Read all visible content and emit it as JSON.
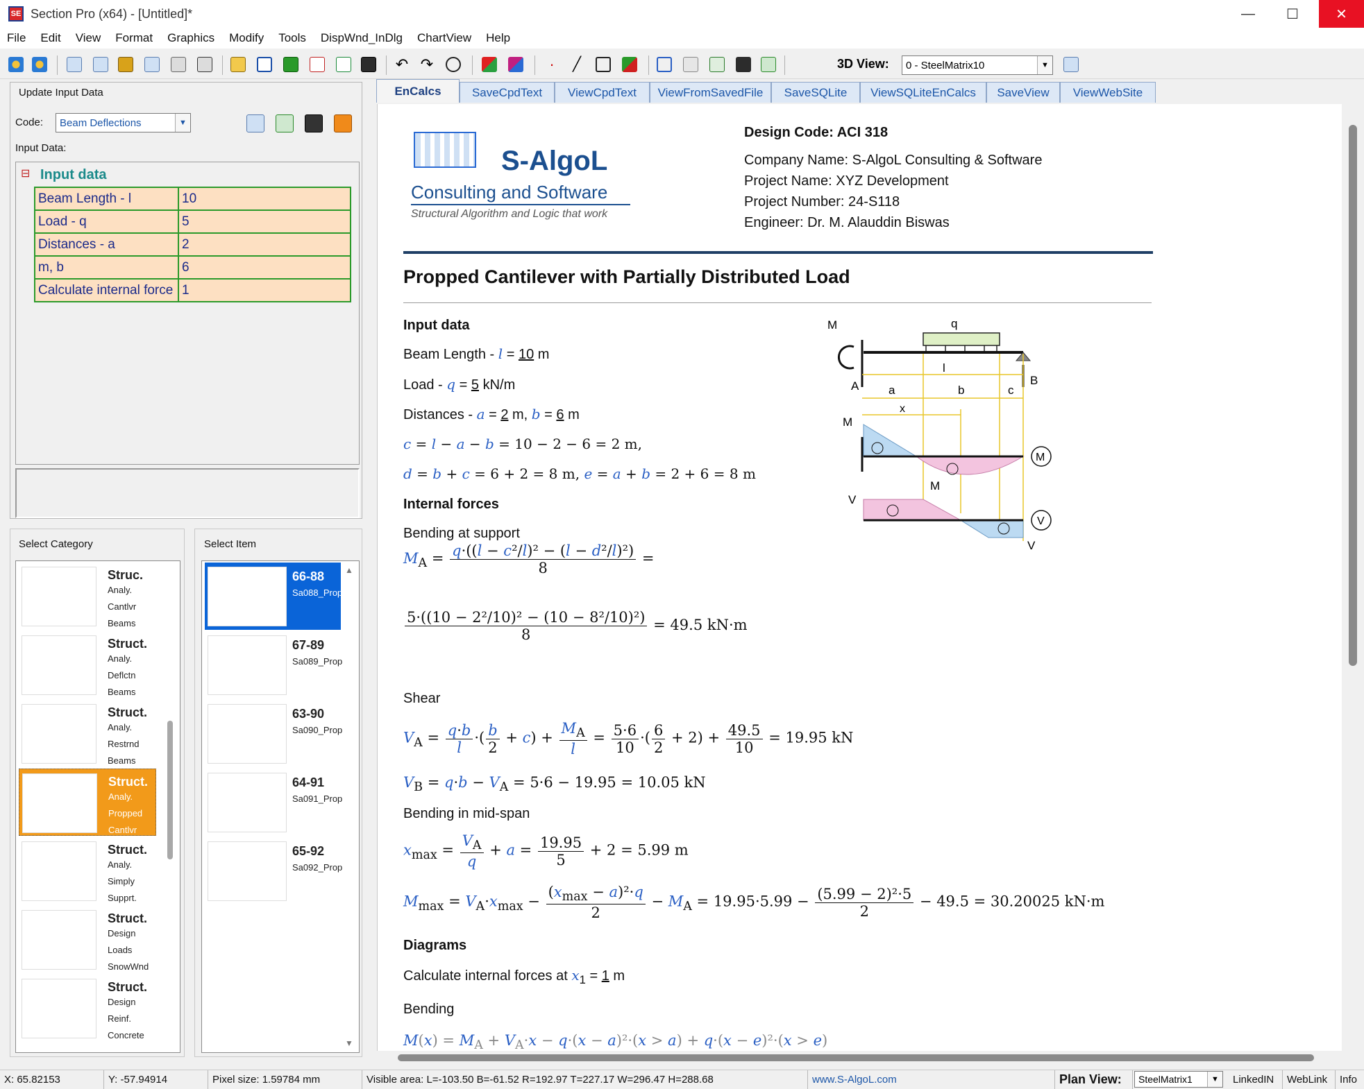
{
  "window": {
    "title": "Section Pro (x64) - [Untitled]*",
    "app_icon_text": "SE",
    "minimize": "—",
    "maximize": "☐",
    "close": "✕"
  },
  "menu": [
    "File",
    "Edit",
    "View",
    "Format",
    "Graphics",
    "Modify",
    "Tools",
    "DispWnd_InDlg",
    "ChartView",
    "Help"
  ],
  "toolbar": {
    "view3d_label": "3D View:",
    "view3d_value": "0 - SteelMatrix10"
  },
  "left": {
    "group_title": "Update Input Data",
    "code_label": "Code:",
    "code_value": "Beam Deflections",
    "input_data_label": "Input Data:",
    "tree_toggle": "⊟",
    "tree_title": "Input data",
    "params": [
      {
        "name": "Beam Length - l",
        "value": "10"
      },
      {
        "name": "Load - q",
        "value": "5"
      },
      {
        "name": "Distances - a",
        "value": "2"
      },
      {
        "name": "m, b",
        "value": "6"
      },
      {
        "name": "Calculate internal force",
        "value": "1"
      }
    ],
    "select_category_label": "Select Category",
    "select_item_label": "Select Item",
    "categories": [
      {
        "title": "Struc.",
        "lines": [
          "Analy.",
          "Cantlvr",
          "Beams"
        ]
      },
      {
        "title": "Struct.",
        "lines": [
          "Analy.",
          "Deflctn",
          "Beams"
        ]
      },
      {
        "title": "Struct.",
        "lines": [
          "Analy.",
          "Restrnd",
          "Beams"
        ]
      },
      {
        "title": "Struct.",
        "lines": [
          "Analy.",
          "Propped",
          "Cantlvr"
        ]
      },
      {
        "title": "Struct.",
        "lines": [
          "Analy.",
          "Simply",
          "Supprt."
        ]
      },
      {
        "title": "Struct.",
        "lines": [
          "Design",
          "Loads",
          "SnowWnd"
        ]
      },
      {
        "title": "Struct.",
        "lines": [
          "Design",
          "Reinf.",
          "Concrete"
        ]
      }
    ],
    "items": [
      {
        "num": "66-88",
        "code": "Sa088_Prop"
      },
      {
        "num": "67-89",
        "code": "Sa089_Prop"
      },
      {
        "num": "63-90",
        "code": "Sa090_Prop"
      },
      {
        "num": "64-91",
        "code": "Sa091_Prop"
      },
      {
        "num": "65-92",
        "code": "Sa092_Prop"
      }
    ]
  },
  "tabs": [
    "EnCalcs",
    "SaveCpdText",
    "ViewCpdText",
    "ViewFromSavedFile",
    "SaveSQLite",
    "ViewSQLiteEnCalcs",
    "SaveView",
    "ViewWebSite"
  ],
  "doc": {
    "logo_main": "S-AlgoL",
    "logo_sub": "Consulting and Software",
    "logo_tag": "Structural Algorithm and Logic that work",
    "design_code": "Design Code: ACI 318",
    "company": "Company Name: S-AlgoL Consulting & Software",
    "project_name": "Project Name: XYZ Development",
    "project_number": "Project Number: 24-S118",
    "engineer": "Engineer: Dr. M. Alauddin Biswas",
    "title": "Propped Cantilever with Partially Distributed Load",
    "h_input": "Input data",
    "beam_length_label": "Beam Length - ",
    "beam_length_value": "10",
    "beam_length_unit": "m",
    "load_label": "Load - ",
    "load_value": "5",
    "load_unit": "kN/m",
    "dist_label": "Distances - ",
    "dist_a": "2",
    "dist_b": "6",
    "c_eq": "= 10 − 2 − 6 = 2 m,",
    "de_eq": "= 6 + 2 = 8 m,",
    "e_eq": "= 2 + 6 = 8 m",
    "h_internal": "Internal forces",
    "bending_support": "Bending at support",
    "ma_result": "= 49.5 kN·m",
    "shear": "Shear",
    "va_result": "= 19.95 kN",
    "vb_line": "= 5·6 − 19.95 = 10.05 kN",
    "bending_mid": "Bending in mid-span",
    "xmax_result": "+ 2 = 5.99 m",
    "mmax_result": "− 49.5 = 30.20025 kN·m",
    "h_diagrams": "Diagrams",
    "calc_at_label": "Calculate internal forces at ",
    "calc_at_value": "1",
    "calc_at_unit": "m",
    "bending": "Bending"
  },
  "diagram_labels": {
    "q": "q",
    "l": "l",
    "a": "a",
    "b": "b",
    "c": "c",
    "A": "A",
    "B": "B",
    "MA": "M",
    "xmax": "x",
    "M": "M",
    "V": "V",
    "VA": "V",
    "VB": "V",
    "Mmax": "M"
  },
  "status": {
    "x": "X: 65.82153",
    "y": "Y: -57.94914",
    "pixel": "Pixel size: 1.59784 mm",
    "visible": "Visible area:  L=-103.50  B=-61.52  R=192.97  T=227.17   W=296.47  H=288.68",
    "website": "www.S-AlgoL.com",
    "plan_view_label": "Plan View:",
    "plan_view_value": "SteelMatrix1",
    "linkedin": "LinkedIN",
    "weblink": "WebLink",
    "info": "Info"
  },
  "colors": {
    "accent_blue": "#2a5fc4",
    "tab_text": "#1c56a8",
    "selection_blue": "#0a64d8",
    "selection_orange": "#f29a1a",
    "table_fill": "#fde0c2",
    "table_border": "#2a9a2a",
    "rule_navy": "#1f3f66",
    "moment_blue": "#bcdaf2",
    "shear_pink": "#f3c4df",
    "load_green": "#dff0c6",
    "guide_yellow": "#e8c62a"
  }
}
